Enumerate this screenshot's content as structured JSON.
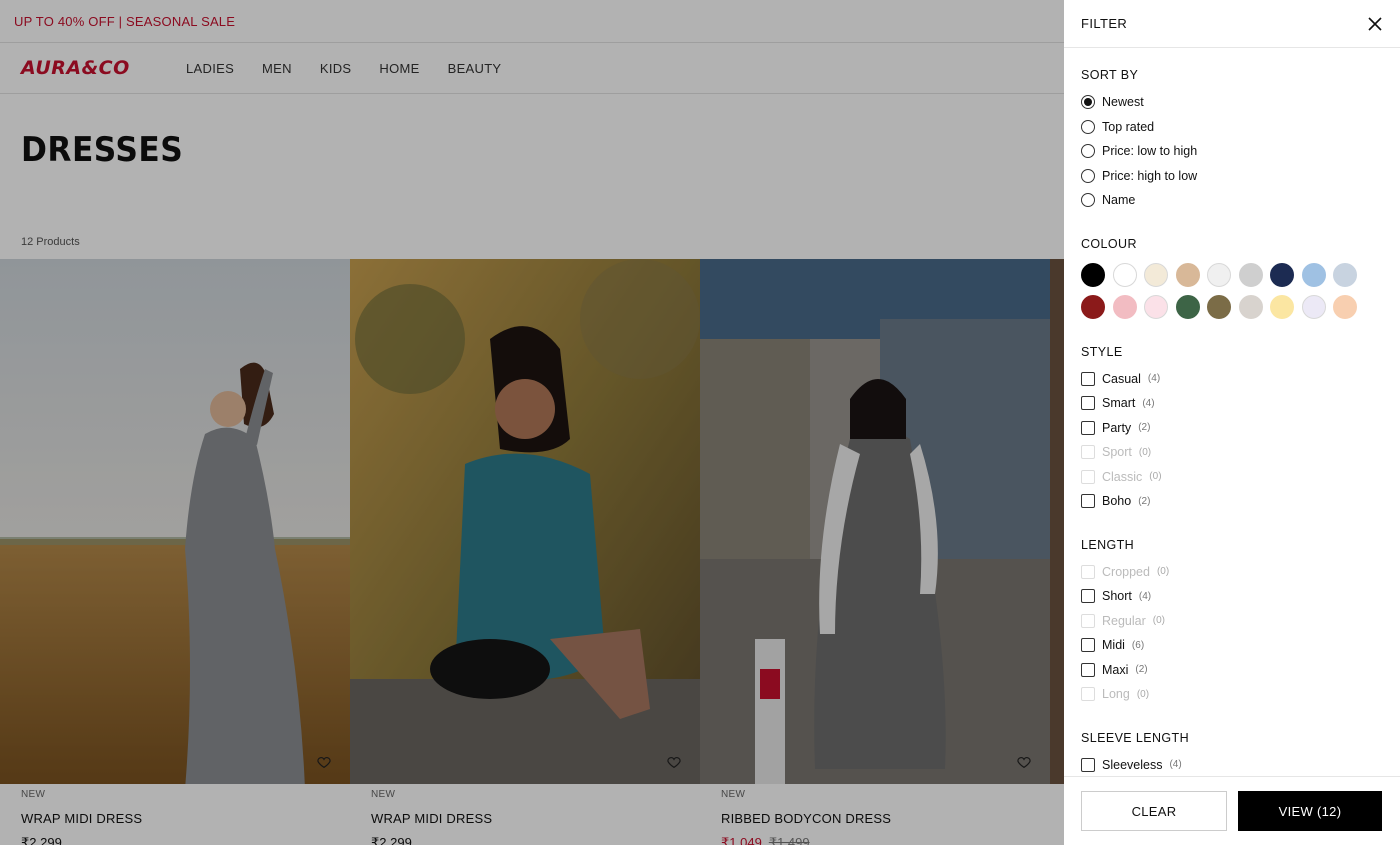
{
  "promo": {
    "text": "UP TO 40% OFF | SEASONAL SALE"
  },
  "header": {
    "logo": "AURA&CO",
    "nav": [
      "LADIES",
      "MEN",
      "KIDS",
      "HOME",
      "BEAUTY"
    ]
  },
  "page": {
    "title": "DRESSES",
    "count": "12 Products"
  },
  "products": [
    {
      "badge": "NEW",
      "name": "WRAP MIDI DRESS",
      "price": "₹2,299",
      "old_price": ""
    },
    {
      "badge": "NEW",
      "name": "WRAP MIDI DRESS",
      "price": "₹2,299",
      "old_price": ""
    },
    {
      "badge": "NEW",
      "name": "RIBBED BODYCON DRESS",
      "price": "₹1,049",
      "old_price": "₹1,499"
    }
  ],
  "filter": {
    "title": "FILTER",
    "sort": {
      "title": "SORT BY",
      "options": [
        "Newest",
        "Top rated",
        "Price: low to high",
        "Price: high to low",
        "Name"
      ],
      "selected": "Newest"
    },
    "colour": {
      "title": "COLOUR",
      "swatches": [
        "#000000",
        "#ffffff",
        "#f3ead8",
        "#d8b898",
        "#f0f0f0",
        "#cfcfcf",
        "#1c2b52",
        "#9fc1e3",
        "#c8d3e0",
        "#8b1a1a",
        "#f2bcc2",
        "#fbe1e8",
        "#3d6446",
        "#7b6c47",
        "#d8d3ce",
        "#fbe6a2",
        "#ece9f6",
        "#f8cfb0"
      ]
    },
    "style": {
      "title": "STYLE",
      "options": [
        {
          "label": "Casual",
          "count": "(4)"
        },
        {
          "label": "Smart",
          "count": "(4)"
        },
        {
          "label": "Party",
          "count": "(2)"
        },
        {
          "label": "Sport",
          "count": "(0)"
        },
        {
          "label": "Classic",
          "count": "(0)"
        },
        {
          "label": "Boho",
          "count": "(2)"
        }
      ]
    },
    "length": {
      "title": "LENGTH",
      "options": [
        {
          "label": "Cropped",
          "count": "(0)"
        },
        {
          "label": "Short",
          "count": "(4)"
        },
        {
          "label": "Regular",
          "count": "(0)"
        },
        {
          "label": "Midi",
          "count": "(6)"
        },
        {
          "label": "Maxi",
          "count": "(2)"
        },
        {
          "label": "Long",
          "count": "(0)"
        }
      ]
    },
    "sleeve": {
      "title": "SLEEVE LENGTH",
      "options": [
        {
          "label": "Sleeveless",
          "count": "(4)"
        }
      ]
    },
    "clear_label": "CLEAR",
    "view_label": "VIEW (12)"
  }
}
